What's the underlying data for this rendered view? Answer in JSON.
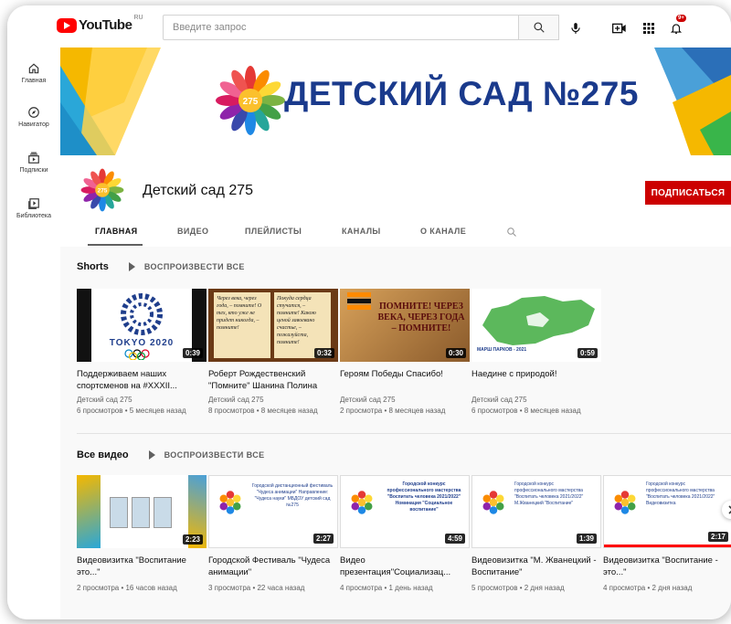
{
  "header": {
    "logo_text": "YouTube",
    "logo_country": "RU",
    "search_placeholder": "Введите запрос",
    "notifications_count": "9+"
  },
  "guide": {
    "items": [
      {
        "label": "Главная",
        "icon": "home-icon"
      },
      {
        "label": "Навигатор",
        "icon": "compass-icon"
      },
      {
        "label": "Подписки",
        "icon": "subscriptions-icon"
      },
      {
        "label": "Библиотека",
        "icon": "library-icon"
      }
    ]
  },
  "banner": {
    "title": "ДЕТСКИЙ САД №275"
  },
  "channel": {
    "name": "Детский сад 275",
    "subscribe_label": "ПОДПИСАТЬСЯ",
    "avatar_number": "275",
    "tabs": [
      "ГЛАВНАЯ",
      "ВИДЕО",
      "ПЛЕЙЛИСТЫ",
      "КАНАЛЫ",
      "О КАНАЛЕ"
    ]
  },
  "shorts": {
    "title": "Shorts",
    "play_all": "ВОСПРОИЗВЕСТИ ВСЕ",
    "items": [
      {
        "title": "Поддерживаем наших спортсменов на #XXXII...",
        "channel": "Детский сад 275",
        "meta": "6 просмотров • 5 месяцев назад",
        "duration": "0:39",
        "thumb_text": "TOKYO 2020"
      },
      {
        "title": "Роберт Рождественский \"Помните\" Шанина Полина",
        "channel": "Детский сад 275",
        "meta": "8 просмотров • 8 месяцев назад",
        "duration": "0:32",
        "thumb_text_left": "Через века, через года, – помните! О тех, кто уже не придет никогда, – помните!",
        "thumb_text_right": "Покуда сердца стучатся, – помните! Какою ценой завоевано счастье, – пожалуйста, помните!"
      },
      {
        "title": "Героям Победы Спасибо!",
        "channel": "Детский сад 275",
        "meta": "2 просмотра • 8 месяцев назад",
        "duration": "0:30",
        "thumb_text": "ПОМНИТЕ! ЧЕРЕЗ ВЕКА, ЧЕРЕЗ ГОДА – ПОМНИТЕ!"
      },
      {
        "title": "Наедине с природой!",
        "channel": "Детский сад 275",
        "meta": "6 просмотров • 8 месяцев назад",
        "duration": "0:59",
        "thumb_text": "МАРШ ПАРКОВ - 2021"
      }
    ]
  },
  "all_videos": {
    "title": "Все видео",
    "play_all": "ВОСПРОИЗВЕСТИ ВСЕ",
    "items": [
      {
        "title": "Видеовизитка \"Воспитание это...\"",
        "meta": "2 просмотра • 16 часов назад",
        "duration": "2:23"
      },
      {
        "title": "Городской Фестиваль \"Чудеса анимации\"",
        "meta": "3 просмотра • 22 часа назад",
        "duration": "2:27",
        "thumb_text": "Городской дистанционный фестиваль \"Чудеса анимации\" Направление: \"Чудеса науки\" МБДОУ детский сад №275"
      },
      {
        "title": "Видео презентация\"Социализац...",
        "meta": "4 просмотра • 1 день назад",
        "duration": "4:59",
        "thumb_text": "Городской конкурс профессионального мастерства \"Воспитать человека 2021/2022\" Номинация \"Социальное воспитание\""
      },
      {
        "title": "Видеовизитка \"М. Жванецкий - Воспитание\"",
        "meta": "5 просмотров • 2 дня назад",
        "duration": "1:39",
        "thumb_text": "Городской конкурс профессионального мастерства \"Воспитать человека 2021/2022\" М.Жванецкий \"Воспитание\""
      },
      {
        "title": "Видеовизитка \"Воспитание - это...\"",
        "meta": "4 просмотра • 2 дня назад",
        "duration": "2:17",
        "thumb_text": "Городской конкурс профессионального мастерства \"Воспитать человека 2021/2022\" Видеовизитка"
      }
    ]
  },
  "colors": {
    "accent_red": "#cc0000",
    "banner_title": "#1a3a8c",
    "text_secondary": "#606060"
  }
}
